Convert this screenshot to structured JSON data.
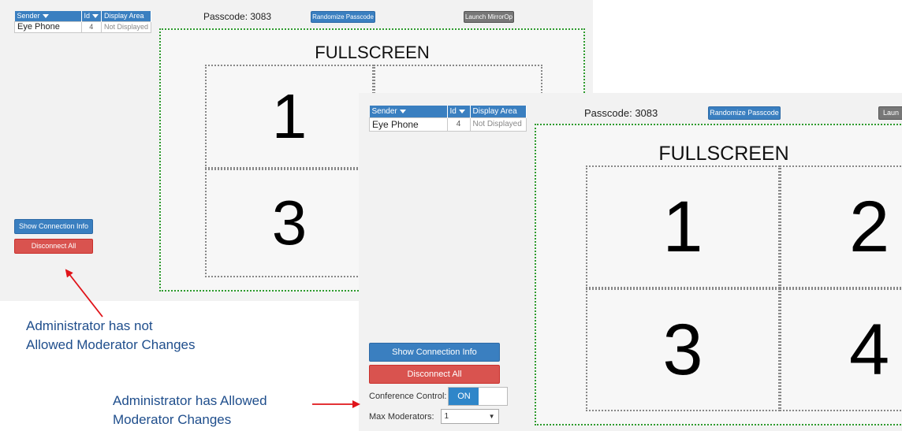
{
  "back": {
    "table": {
      "col_sender": "Sender",
      "col_id": "Id",
      "col_area": "Display Area",
      "row": {
        "sender": "Eye Phone",
        "id": "4",
        "area": "Not Displayed"
      }
    },
    "passcode": "Passcode: 3083",
    "randomize_label": "Randomize Passcode",
    "launch_label": "Launch MirrorOp",
    "fullscreen": "FULLSCREEN",
    "quads": [
      "1",
      "3"
    ],
    "show_connection_label": "Show Connection Info",
    "disconnect_label": "Disconnect All"
  },
  "front": {
    "table": {
      "col_sender": "Sender",
      "col_id": "Id",
      "col_area": "Display Area",
      "row": {
        "sender": "Eye Phone",
        "id": "4",
        "area": "Not Displayed"
      }
    },
    "passcode": "Passcode: 3083",
    "randomize_label": "Randomize Passcode",
    "launch_label": "Laun",
    "fullscreen": "FULLSCREEN",
    "quads": [
      "1",
      "2",
      "3",
      "4"
    ],
    "show_connection_label": "Show Connection Info",
    "disconnect_label": "Disconnect All",
    "conference_label": "Conference Control:",
    "conference_value": "ON",
    "max_moderators_label": "Max Moderators:",
    "max_moderators_value": "1"
  },
  "annotations": {
    "not_allowed_line1": "Administrator has not",
    "not_allowed_line2": "Allowed Moderator Changes",
    "allowed_line1": "Administrator has Allowed",
    "allowed_line2": "Moderator Changes"
  },
  "colors": {
    "arrow": "#e0141a",
    "accent": "#3a7fc0",
    "danger": "#d9534f",
    "display_border": "#2e9b2e"
  }
}
